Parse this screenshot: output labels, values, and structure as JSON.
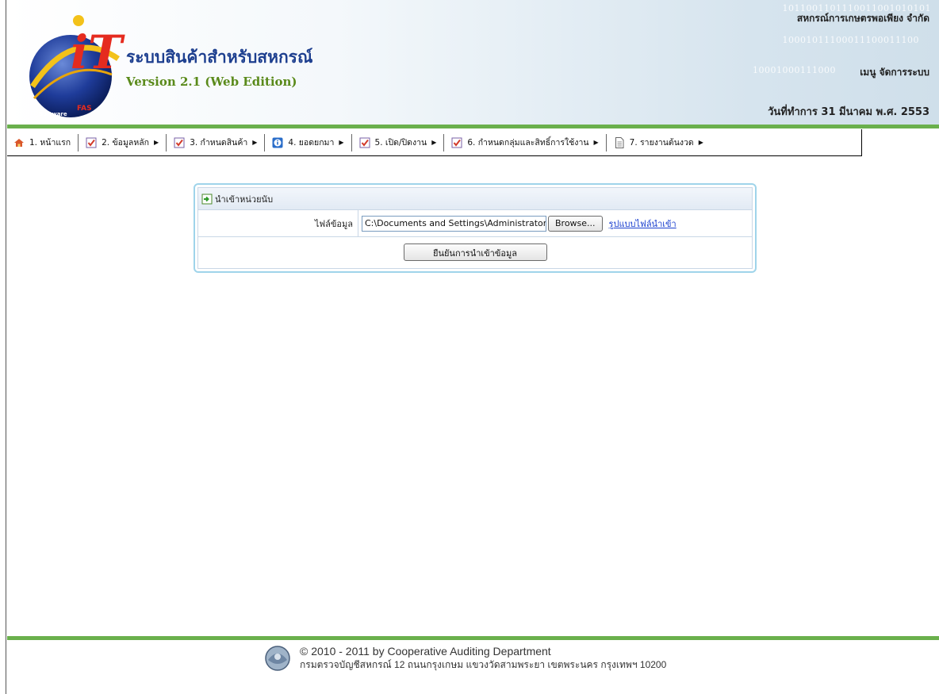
{
  "header": {
    "app_title": "ระบบสินค้าสำหรับสหกรณ์",
    "version": "Version 2.1 (Web Edition)",
    "org_name": "สหกรณ์การเกษตรพอเพียง จำกัด",
    "menu_label": "เมนู จัดการระบบ",
    "work_date": "วันที่ทำการ 31 มีนาคม พ.ศ. 2553",
    "logo_text": "iT FAS Full Pack Accounting Software",
    "binary_lines": [
      "1011001101110011001010101",
      "10001011100011100011100",
      "10001000111000"
    ]
  },
  "menu": {
    "items": [
      {
        "label": "1. หน้าแรก",
        "icon": "home-icon",
        "has_submenu": false
      },
      {
        "label": "2. ข้อมูลหลัก",
        "icon": "checklist-icon",
        "has_submenu": true
      },
      {
        "label": "3. กำหนดสินค้า",
        "icon": "checklist-icon",
        "has_submenu": true
      },
      {
        "label": "4. ยอดยกมา",
        "icon": "info-icon",
        "has_submenu": true
      },
      {
        "label": "5. เปิด/ปิดงาน",
        "icon": "checklist-icon",
        "has_submenu": true
      },
      {
        "label": "6. กำหนดกลุ่มและสิทธิ์การใช้งาน",
        "icon": "checklist-icon",
        "has_submenu": true
      },
      {
        "label": "7. รายงานต้นงวด",
        "icon": "document-icon",
        "has_submenu": true
      }
    ]
  },
  "import_panel": {
    "title": "นำเข้าหน่วยนับ",
    "file_label": "ไฟล์ข้อมูล",
    "file_value": "C:\\Documents and Settings\\Administrator",
    "browse_label": "Browse...",
    "format_link": "รูปแบบไฟล์นำเข้า",
    "confirm_label": "ยืนยันการนำเข้าข้อมูล"
  },
  "footer": {
    "copyright": "© 2010 - 2011  by Cooperative Auditing Department",
    "address": "กรมตรวจบัญชีสหกรณ์ 12 ถนนกรุงเกษม แขวงวัดสามพระยา เขตพระนคร กรุงเทพฯ 10200"
  },
  "colors": {
    "accent_green": "#6ab04c",
    "title_blue": "#1d3f8f",
    "version_green": "#5a8a1a",
    "link_blue": "#1a3fcf",
    "panel_border": "#9fd4ea"
  }
}
